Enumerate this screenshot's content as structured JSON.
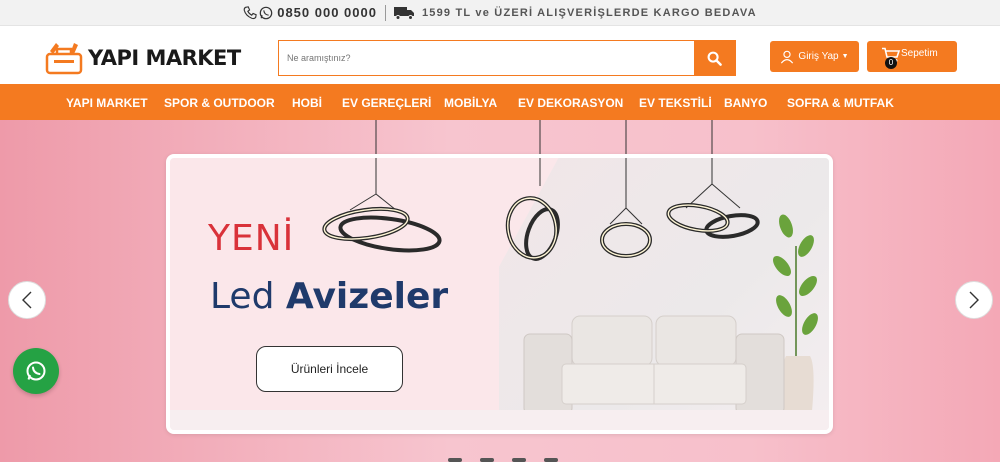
{
  "topbar": {
    "phone": "0850 000 0000",
    "cargo": "1599 TL ve ÜZERİ ALIŞVERİŞLERDE KARGO BEDAVA"
  },
  "header": {
    "logo_text": "YAPI MARKET",
    "search_placeholder": "Ne aramıştınız?",
    "login_label": "Giriş Yap",
    "cart_label": "Sepetim",
    "cart_count": "0"
  },
  "nav": {
    "items": [
      {
        "label": "YAPI MARKET"
      },
      {
        "label": "SPOR & OUTDOOR"
      },
      {
        "label": "HOBİ"
      },
      {
        "label": "EV GEREÇLERİ"
      },
      {
        "label": "MOBİLYA"
      },
      {
        "label": "EV DEKORASYON"
      },
      {
        "label": "EV TEKSTİLİ"
      },
      {
        "label": "BANYO"
      },
      {
        "label": "SOFRA & MUTFAK"
      }
    ]
  },
  "hero": {
    "headline_1": "YENİ",
    "headline_2_light": "Led ",
    "headline_2_bold": "Avizeler",
    "cta": "Ürünleri İncele"
  },
  "colors": {
    "accent": "#f47a20",
    "headline_red": "#d9323a",
    "headline_blue": "#1f3a6b",
    "whatsapp": "#25a244"
  },
  "icons": [
    "phone-icon",
    "whatsapp-icon",
    "truck-icon",
    "search-icon",
    "user-icon",
    "cart-icon",
    "chevron-left-icon",
    "chevron-right-icon"
  ]
}
